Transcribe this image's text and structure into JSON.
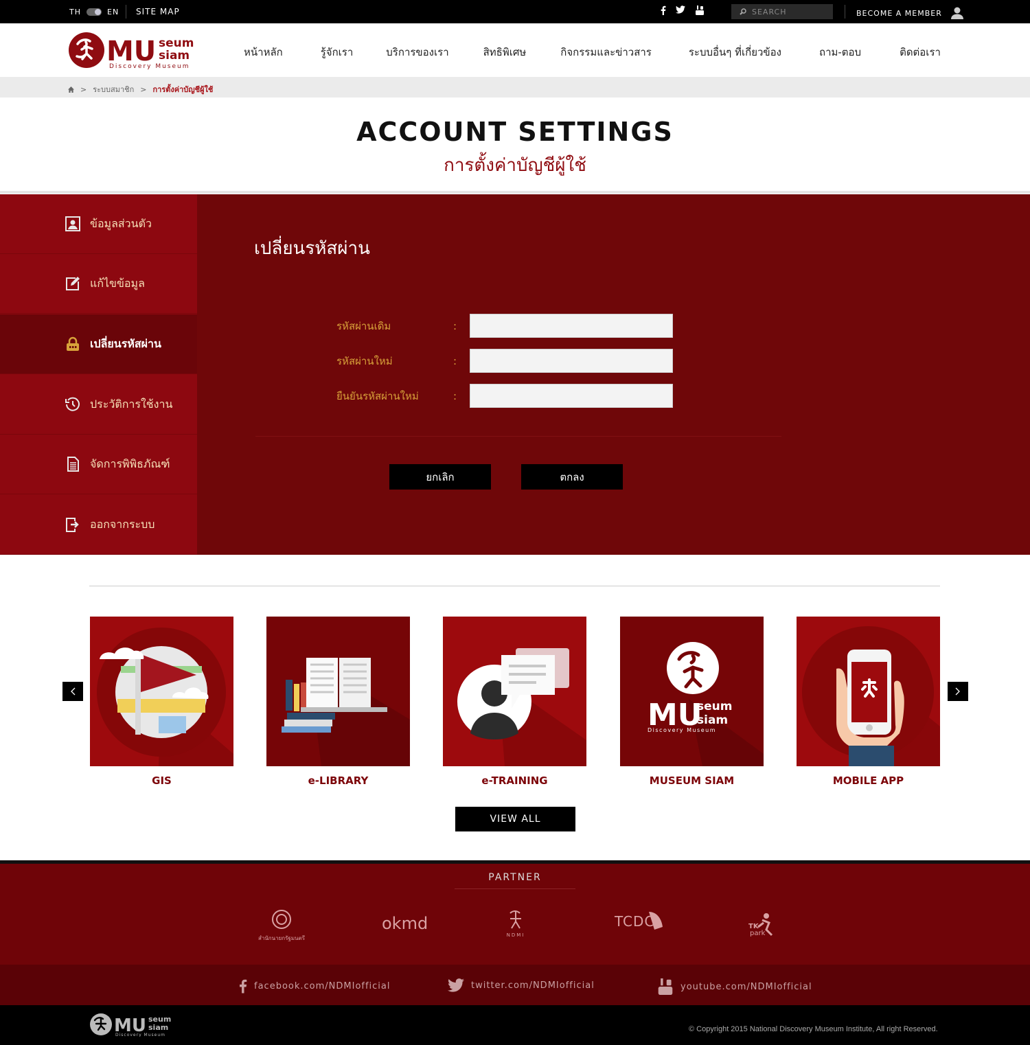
{
  "topbar": {
    "lang_th": "TH",
    "lang_en": "EN",
    "sitemap": "SITE MAP",
    "search_placeholder": "SEARCH",
    "member": "BECOME A MEMBER"
  },
  "logo": {
    "line1": "MU",
    "line2a": "seum",
    "line2b": "siam",
    "line3": "Discovery Museum"
  },
  "nav": [
    "หน้าหลัก",
    "รู้จักเรา",
    "บริการของเรา",
    "สิทธิพิเศษ",
    "กิจกรรมและข่าวสาร",
    "ระบบอื่นๆ ที่เกี่ยวข้อง",
    "ถาม-ตอบ",
    "ติดต่อเรา"
  ],
  "breadcrumb": {
    "level1": "ระบบสมาชิก",
    "current": "การตั้งค่าบัญชีผู้ใช้"
  },
  "page": {
    "title_en": "ACCOUNT SETTINGS",
    "title_th": "การตั้งค่าบัญชีผู้ใช้"
  },
  "sidebar": {
    "items": [
      {
        "label": "ข้อมูลส่วนตัว",
        "icon": "profile-icon"
      },
      {
        "label": "แก้ไขข้อมูล",
        "icon": "edit-icon"
      },
      {
        "label": "เปลี่ยนรหัสผ่าน",
        "icon": "lock-icon",
        "active": true
      },
      {
        "label": "ประวัติการใช้งาน",
        "icon": "history-icon"
      },
      {
        "label": "จัดการพิพิธภัณฑ์",
        "icon": "document-icon"
      },
      {
        "label": "ออกจากระบบ",
        "icon": "logout-icon"
      }
    ]
  },
  "form": {
    "title": "เปลี่ยนรหัสผ่าน",
    "old_password_label": "รหัสผ่านเดิม",
    "new_password_label": "รหัสผ่านใหม่",
    "confirm_password_label": "ยืนยันรหัสผ่านใหม่",
    "colon": ":",
    "cancel": "ยกเลิก",
    "submit": "ตกลง"
  },
  "services": [
    {
      "label": "GIS"
    },
    {
      "label": "e-LIBRARY"
    },
    {
      "label": "e-TRAINING"
    },
    {
      "label": "MUSEUM SIAM"
    },
    {
      "label": "MOBILE APP"
    }
  ],
  "view_all": "VIEW ALL",
  "partner": {
    "title": "PARTNER",
    "okmd": "okmd",
    "ndmi": "NDMI",
    "tcdc": "TCDC",
    "tk": "TK",
    "tk_park": "park",
    "opm": "สำนักนายกรัฐมนตรี"
  },
  "social": {
    "facebook": "facebook.com/NDMIofficial",
    "twitter": "twitter.com/NDMIofficial",
    "youtube": "youtube.com/NDMIofficial"
  },
  "footer": {
    "copyright": "Copyright 2015 National Discovery Museum Institute, All right Reserved."
  },
  "colors": {
    "brand_red": "#8d0810",
    "dark_red": "#6f0709",
    "gold": "#d8a23a"
  }
}
